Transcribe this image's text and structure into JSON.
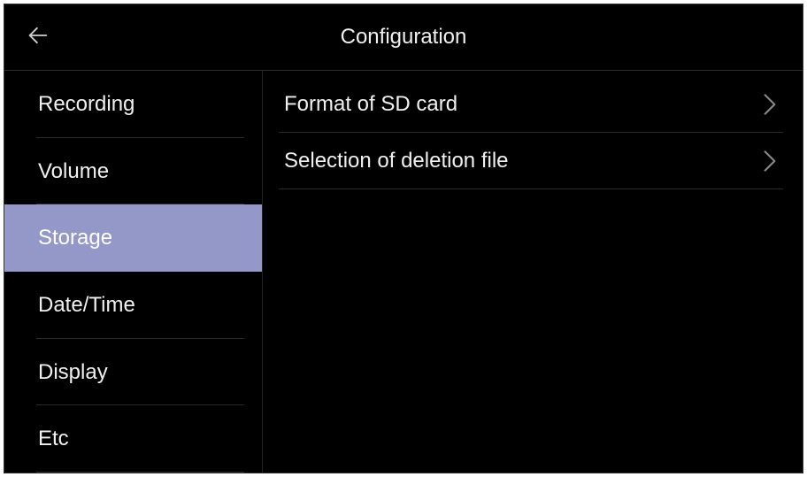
{
  "header": {
    "title": "Configuration"
  },
  "sidebar": {
    "items": [
      {
        "label": "Recording",
        "active": false
      },
      {
        "label": "Volume",
        "active": false
      },
      {
        "label": "Storage",
        "active": true
      },
      {
        "label": "Date/Time",
        "active": false
      },
      {
        "label": "Display",
        "active": false
      },
      {
        "label": "Etc",
        "active": false
      }
    ]
  },
  "main": {
    "items": [
      {
        "label": "Format of SD card"
      },
      {
        "label": "Selection of deletion file"
      }
    ]
  }
}
